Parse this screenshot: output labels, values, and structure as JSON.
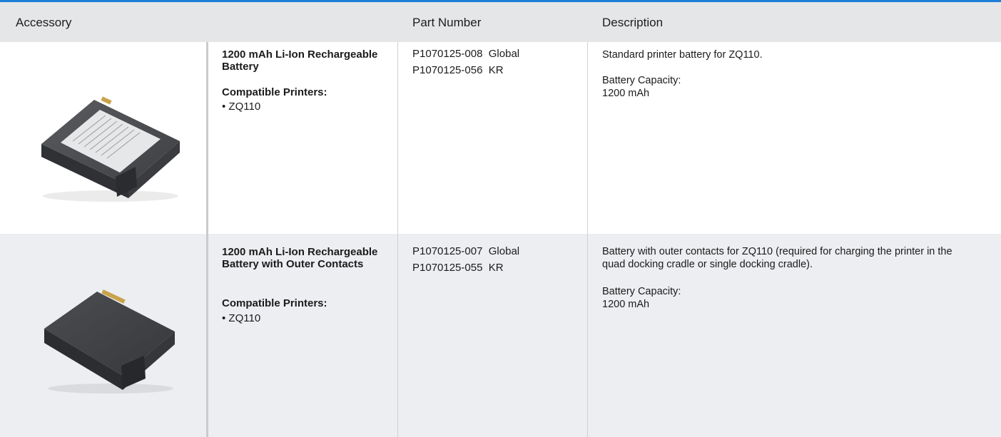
{
  "header": {
    "accessory": "Accessory",
    "part_number": "Part Number",
    "description": "Description"
  },
  "rows": [
    {
      "name": "1200 mAh Li-Ion Rechargeable Battery",
      "compatible_label": "Compatible Printers:",
      "compatible_item": "• ZQ110",
      "part_numbers": [
        "P1070125-008  Global",
        "P1070125-056  KR"
      ],
      "description": "Standard printer battery for ZQ110.",
      "capacity_label": "Battery Capacity:",
      "capacity_value": "1200 mAh"
    },
    {
      "name": "1200 mAh Li-Ion Rechargeable Battery with Outer Contacts",
      "compatible_label": "Compatible Printers:",
      "compatible_item": "• ZQ110",
      "part_numbers": [
        "P1070125-007  Global",
        "P1070125-055  KR"
      ],
      "description": "Battery with outer contacts for ZQ110 (required for charging the printer in the quad docking cradle or single docking cradle).",
      "capacity_label": "Battery Capacity:",
      "capacity_value": "1200 mAh"
    }
  ],
  "colors": {
    "accent": "#1f7fd6",
    "header_bg": "#e5e6e8",
    "alt_row_bg": "#eceef1"
  },
  "icons": [
    "battery-image",
    "battery-outer-contacts-image"
  ]
}
